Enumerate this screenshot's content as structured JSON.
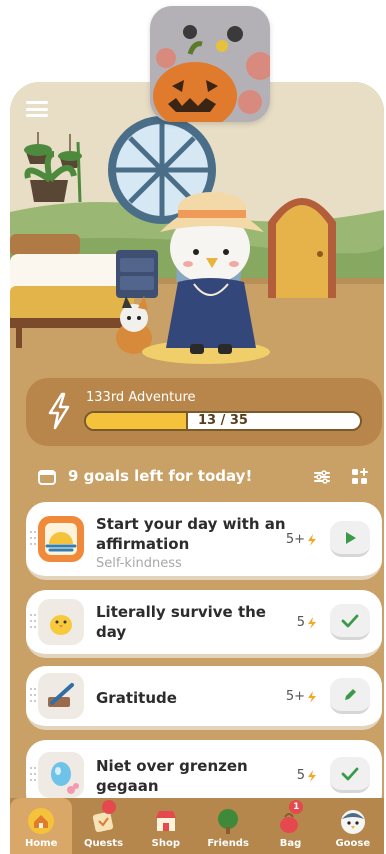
{
  "app_icon": {
    "name": "pumpkin-goose-app-icon"
  },
  "scene": {
    "menu_icon": "hamburger-icon"
  },
  "adventure": {
    "title": "133rd Adventure",
    "progress_text": "13 / 35",
    "progress_current": 13,
    "progress_total": 35,
    "icon": "lightning-icon"
  },
  "goals": {
    "header": "9 goals left for today!",
    "items": [
      {
        "title": "Start your day with an affirmation",
        "subtitle": "Self-kindness",
        "energy": "5+",
        "action": "play",
        "thumb": "sunrise-icon"
      },
      {
        "title": "Literally survive the day",
        "subtitle": "",
        "energy": "5",
        "action": "check",
        "thumb": "chick-icon"
      },
      {
        "title": "Gratitude",
        "subtitle": "",
        "energy": "5+",
        "action": "edit",
        "thumb": "journal-pen-icon"
      },
      {
        "title": "Niet over grenzen gegaan",
        "subtitle": "",
        "energy": "5",
        "action": "check",
        "thumb": "egg-icon"
      }
    ]
  },
  "nav": {
    "items": [
      {
        "label": "Home",
        "active": true
      },
      {
        "label": "Quests"
      },
      {
        "label": "Shop"
      },
      {
        "label": "Friends"
      },
      {
        "label": "Bag",
        "badge": "1"
      },
      {
        "label": "Goose"
      }
    ]
  },
  "colors": {
    "background": "#c9a065",
    "panel": "#b8864a",
    "accent_yellow": "#f5c23b",
    "action_green": "#3a9a4a",
    "nav": "#b5874c"
  }
}
